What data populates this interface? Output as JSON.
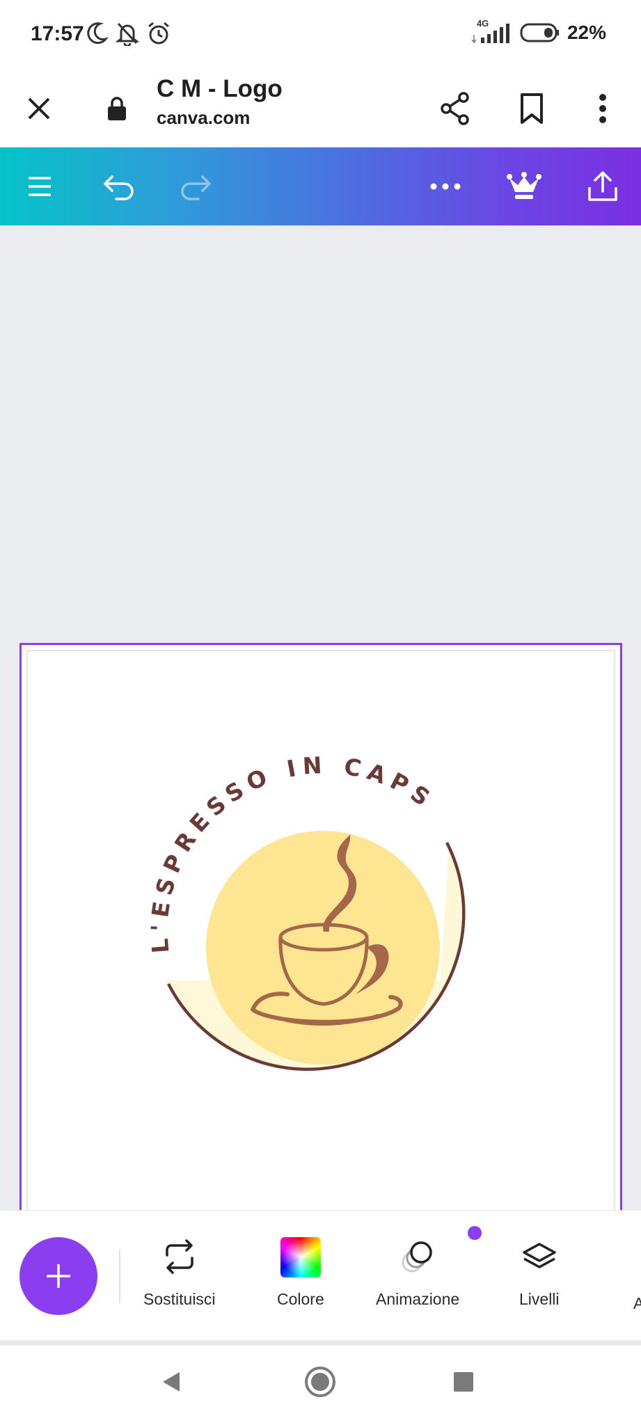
{
  "status_bar": {
    "time": "17:57",
    "network": "4G",
    "battery": "22%"
  },
  "browser": {
    "title": "C M - Logo",
    "url": "canva.com"
  },
  "design": {
    "logo_text": "L'ESPRESSO IN CAPSULE",
    "colors": {
      "brown": "#6b3a37",
      "cup": "#a5674a",
      "yellow": "#fde592",
      "cream": "#fef7d8"
    }
  },
  "bottom_tools": {
    "items": [
      {
        "label": "Sostituisci",
        "icon": "replace-icon"
      },
      {
        "label": "Colore",
        "icon": "color-swatch-icon"
      },
      {
        "label": "Animazione",
        "icon": "animation-icon"
      },
      {
        "label": "Livelli",
        "icon": "layers-icon"
      }
    ],
    "overflow_label": "A"
  },
  "accent": "#8b3df0"
}
